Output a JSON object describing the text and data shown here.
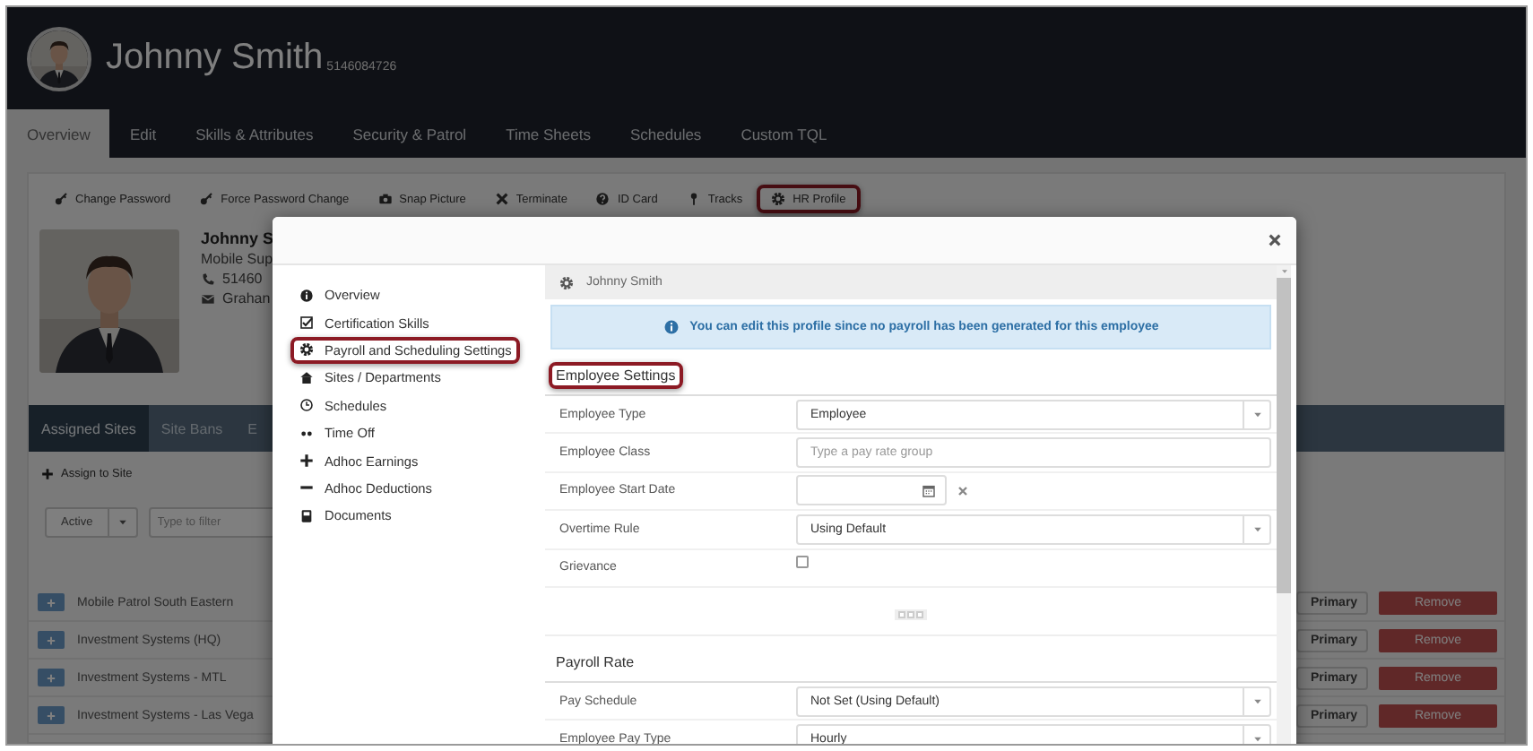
{
  "header": {
    "name": "Johnny Smith",
    "id_number": "5146084726"
  },
  "tabs": [
    {
      "label": "Overview",
      "selected": true
    },
    {
      "label": "Edit",
      "selected": false
    },
    {
      "label": "Skills & Attributes",
      "selected": false
    },
    {
      "label": "Security & Patrol",
      "selected": false
    },
    {
      "label": "Time Sheets",
      "selected": false
    },
    {
      "label": "Schedules",
      "selected": false
    },
    {
      "label": "Custom TQL",
      "selected": false
    }
  ],
  "actions": [
    {
      "label": "Change Password",
      "highlighted": false
    },
    {
      "label": "Force Password Change",
      "highlighted": false
    },
    {
      "label": "Snap Picture",
      "highlighted": false
    },
    {
      "label": "Terminate",
      "highlighted": false
    },
    {
      "label": "ID Card",
      "highlighted": false
    },
    {
      "label": "Tracks",
      "highlighted": false
    },
    {
      "label": "HR Profile",
      "highlighted": true
    }
  ],
  "card": {
    "name": "Johnny S",
    "title": "Mobile Sup",
    "phone": "51460",
    "email": "Grahan"
  },
  "site_tabs": [
    {
      "label": "Assigned Sites",
      "selected": true
    },
    {
      "label": "Site Bans",
      "selected": false
    },
    {
      "label": "E",
      "selected": false
    }
  ],
  "assign_button": "Assign to Site",
  "filter": {
    "status": "Active",
    "placeholder": "Type to filter"
  },
  "sites": [
    {
      "name": "Mobile Patrol South Eastern",
      "primary": "Primary",
      "remove": "Remove"
    },
    {
      "name": "Investment Systems (HQ)",
      "primary": "Primary",
      "remove": "Remove"
    },
    {
      "name": "Investment Systems - MTL",
      "primary": "Primary",
      "remove": "Remove"
    },
    {
      "name": "Investment Systems - Las Vega",
      "primary": "Primary",
      "remove": "Remove"
    }
  ],
  "modal": {
    "nav": [
      {
        "label": "Overview",
        "highlighted": false
      },
      {
        "label": "Certification Skills",
        "highlighted": false
      },
      {
        "label": "Payroll and Scheduling Settings",
        "highlighted": true
      },
      {
        "label": "Sites / Departments",
        "highlighted": false
      },
      {
        "label": "Schedules",
        "highlighted": false
      },
      {
        "label": "Time Off",
        "highlighted": false
      },
      {
        "label": "Adhoc Earnings",
        "highlighted": false
      },
      {
        "label": "Adhoc Deductions",
        "highlighted": false
      },
      {
        "label": "Documents",
        "highlighted": false
      }
    ],
    "pane_title": "Johnny Smith",
    "notice": "You can edit this profile since no payroll has been generated for this employee",
    "sections": [
      {
        "title": "Employee Settings",
        "highlighted": true,
        "more": true,
        "fields": [
          {
            "label": "Employee Type",
            "kind": "select",
            "value": "Employee"
          },
          {
            "label": "Employee Class",
            "kind": "text",
            "placeholder": "Type a pay rate group"
          },
          {
            "label": "Employee Start Date",
            "kind": "date"
          },
          {
            "label": "Overtime Rule",
            "kind": "select",
            "value": "Using Default"
          },
          {
            "label": "Grievance",
            "kind": "checkbox",
            "checked": false
          }
        ]
      },
      {
        "title": "Payroll Rate",
        "highlighted": false,
        "more": false,
        "fields": [
          {
            "label": "Pay Schedule",
            "kind": "select",
            "value": "Not Set (Using Default)"
          },
          {
            "label": "Employee Pay Type",
            "kind": "select",
            "value": "Hourly"
          }
        ]
      }
    ]
  }
}
